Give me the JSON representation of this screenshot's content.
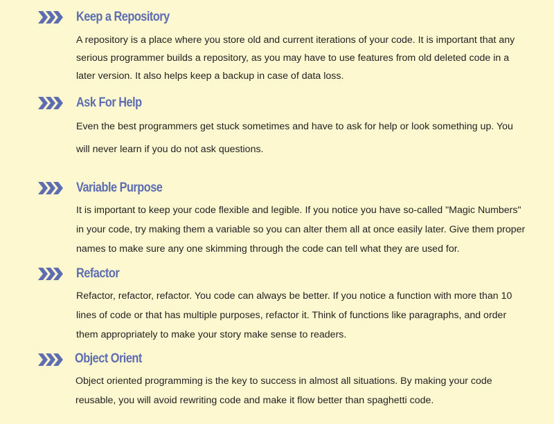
{
  "tips": [
    {
      "title": "Keep a Repository",
      "body": "A repository is a place where you store old and current iterations of your code. It is important that any serious programmer builds a repository, as you may have to use features from old deleted code in a later version. It also helps keep a backup in case of data loss.",
      "icon": "triple-chevron-icon"
    },
    {
      "title": "Ask For Help",
      "body": "Even the best programmers get stuck sometimes and have to ask for help or look something up. You will never learn if you do not ask questions.",
      "icon": "triple-chevron-icon"
    },
    {
      "title": "Variable Purpose",
      "body": "It is important to keep your code flexible and legible. If you notice you have so-called \"Magic Numbers\" in your code, try making them a variable so you can alter them all at once easily later. Give them proper names to make sure any one skimming through the code can tell what they are used for.",
      "icon": "triple-chevron-icon"
    },
    {
      "title": "Refactor",
      "body": "Refactor, refactor, refactor. You code can always be better. If you notice a function with more than 10 lines of code or that has multiple purposes, refactor it. Think of functions like paragraphs, and order them appropriately to make your story make sense to readers.",
      "icon": "triple-chevron-icon"
    },
    {
      "title": "Object Orient",
      "body": "Object oriented programming is the key to success in almost all situations. By making your code reusable, you will avoid rewriting code and make it flow better than spaghetti code.",
      "icon": "triple-chevron-icon"
    }
  ],
  "colors": {
    "background": "#fdf8d0",
    "accent": "#5d6db0",
    "text": "#222222"
  }
}
